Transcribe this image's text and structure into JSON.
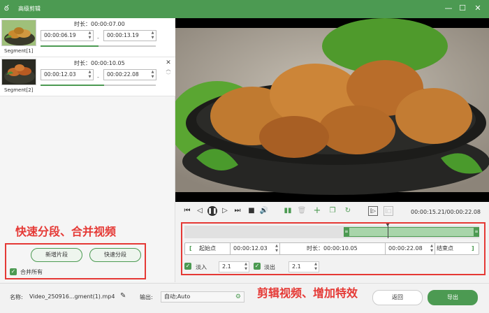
{
  "window": {
    "title": "高级剪辑",
    "minimize": "—",
    "maximize": "☐",
    "close": "✕"
  },
  "segments": [
    {
      "label": "Segment[1]",
      "duration_label": "时长：",
      "duration": "00:00:07.00",
      "start": "00:00:06.19",
      "end": "00:00:13.19",
      "progress": 0.5
    },
    {
      "label": "Segment[2]",
      "duration_label": "时长：",
      "duration": "00:00:10.05",
      "start": "00:00:12.03",
      "end": "00:00:22.08",
      "progress": 0.55
    }
  ],
  "segment_separator": "-",
  "left_actions": {
    "add_segment": "新增片段",
    "quick_split": "快速分段",
    "merge_all": "合并所有"
  },
  "annotations": {
    "left": "快速分段、合并视频",
    "right": "剪辑视频、增加特效"
  },
  "player": {
    "time": "00:00:15.21/00:00:22.08",
    "timeline_selection_start": 0.54,
    "timeline_selection_end": 1.0,
    "timeline_playhead": 0.69
  },
  "trim": {
    "start_label": "起始点",
    "start_value": "00:00:12.03",
    "duration_label": "时长：",
    "duration_value": "00:00:10.05",
    "end_value": "00:00:22.08",
    "end_label": "结束点",
    "open_bracket": "[",
    "close_bracket": "]"
  },
  "effects": {
    "fade_in_label": "淡入",
    "fade_in_value": "2.1",
    "fade_out_label": "淡出",
    "fade_out_value": "2.1"
  },
  "footer": {
    "name_label": "名称:",
    "name_value": "Video_250916...gment(1).mp4",
    "output_label": "输出:",
    "output_value": "自动;Auto",
    "back_button": "返回",
    "export_button": "导出"
  },
  "colors": {
    "accent": "#4c9a52",
    "annotation": "#e53935"
  }
}
